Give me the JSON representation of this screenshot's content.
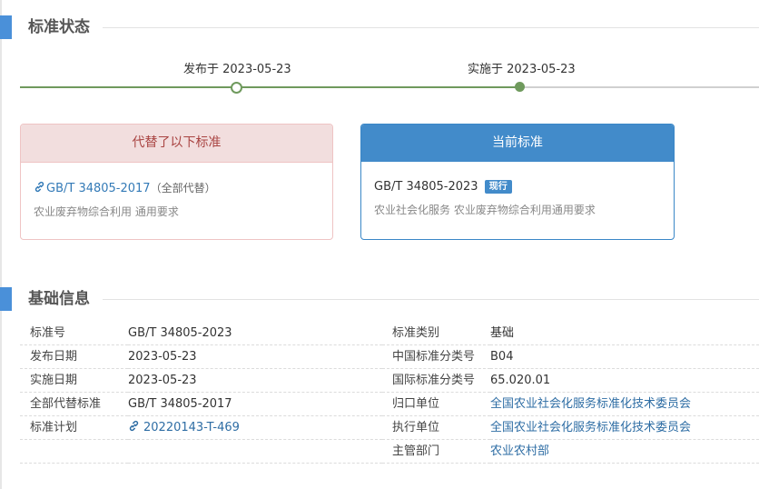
{
  "status_section": {
    "title": "标准状态",
    "timeline": {
      "published_label": "发布于 2023-05-23",
      "implemented_label": "实施于 2023-05-23"
    }
  },
  "replaced_card": {
    "header": "代替了以下标准",
    "standard_code": "GB/T 34805-2017",
    "note": "（全部代替）",
    "description": "农业废弃物综合利用 通用要求"
  },
  "current_card": {
    "header": "当前标准",
    "standard_code": "GB/T 34805-2023",
    "badge": "现行",
    "description": "农业社会化服务 农业废弃物综合利用通用要求"
  },
  "basic_section": {
    "title": "基础信息",
    "rows": [
      {
        "k1": "标准号",
        "v1": "GB/T 34805-2023",
        "k2": "标准类别",
        "v2": "基础"
      },
      {
        "k1": "发布日期",
        "v1": "2023-05-23",
        "k2": "中国标准分类号",
        "v2": "B04"
      },
      {
        "k1": "实施日期",
        "v1": "2023-05-23",
        "k2": "国际标准分类号",
        "v2": "65.020.01"
      },
      {
        "k1": "全部代替标准",
        "v1": "GB/T 34805-2017",
        "k2": "归口单位",
        "v2": "全国农业社会化服务标准化技术委员会"
      },
      {
        "k1": "标准计划",
        "v1": "20220143-T-469",
        "k2": "执行单位",
        "v2": "全国农业社会化服务标准化技术委员会"
      },
      {
        "k1": "",
        "v1": "",
        "k2": "主管部门",
        "v2": "农业农村部"
      }
    ]
  },
  "colors": {
    "accent": "#4a90d9",
    "timeline_green": "#6f9a5d",
    "replaced_header_bg": "#f2dede",
    "replaced_header_text": "#a94442",
    "current_header_bg": "#428bca",
    "link": "#337ab7"
  }
}
